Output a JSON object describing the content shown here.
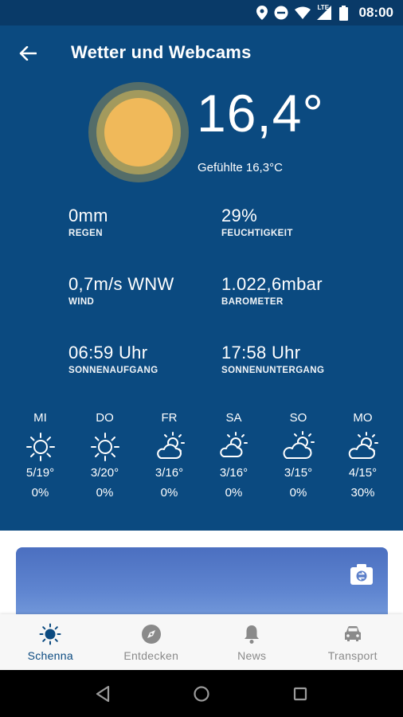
{
  "status_bar": {
    "time": "08:00",
    "network": "LTE"
  },
  "header": {
    "title": "Wetter und Webcams"
  },
  "current": {
    "temperature": "16,4°",
    "felt": "Gefühlte 16,3°C",
    "icon": "sun-icon"
  },
  "stats": {
    "rain": {
      "value": "0mm",
      "label": "REGEN"
    },
    "humidity": {
      "value": "29%",
      "label": "FEUCHTIGKEIT"
    },
    "wind": {
      "value": "0,7m/s WNW",
      "label": "WIND"
    },
    "barometer": {
      "value": "1.022,6mbar",
      "label": "BAROMETER"
    },
    "sunrise": {
      "value": "06:59 Uhr",
      "label": "SONNENAUFGANG"
    },
    "sunset": {
      "value": "17:58 Uhr",
      "label": "SONNENUNTERGANG"
    }
  },
  "forecast": [
    {
      "day": "MI",
      "temp": "5/19°",
      "precip": "0%",
      "icon": "sun-icon"
    },
    {
      "day": "DO",
      "temp": "3/20°",
      "precip": "0%",
      "icon": "sun-icon"
    },
    {
      "day": "FR",
      "temp": "3/16°",
      "precip": "0%",
      "icon": "partly-cloudy-icon"
    },
    {
      "day": "SA",
      "temp": "3/16°",
      "precip": "0%",
      "icon": "partly-cloudy-icon"
    },
    {
      "day": "SO",
      "temp": "3/15°",
      "precip": "0%",
      "icon": "partly-cloudy-icon"
    },
    {
      "day": "MO",
      "temp": "4/15°",
      "precip": "30%",
      "icon": "partly-cloudy-icon"
    }
  ],
  "webcam": {
    "icon": "camera-icon"
  },
  "bottom_nav": [
    {
      "label": "Schenna",
      "icon": "sun-icon",
      "active": true
    },
    {
      "label": "Entdecken",
      "icon": "compass-icon",
      "active": false
    },
    {
      "label": "News",
      "icon": "bell-icon",
      "active": false
    },
    {
      "label": "Transport",
      "icon": "car-icon",
      "active": false
    }
  ],
  "colors": {
    "panel": "#0b4a80",
    "status_bar": "#093a68",
    "sun": "#f0b95a",
    "active_nav": "#0b4a80",
    "inactive_nav": "#8a8a8a"
  }
}
